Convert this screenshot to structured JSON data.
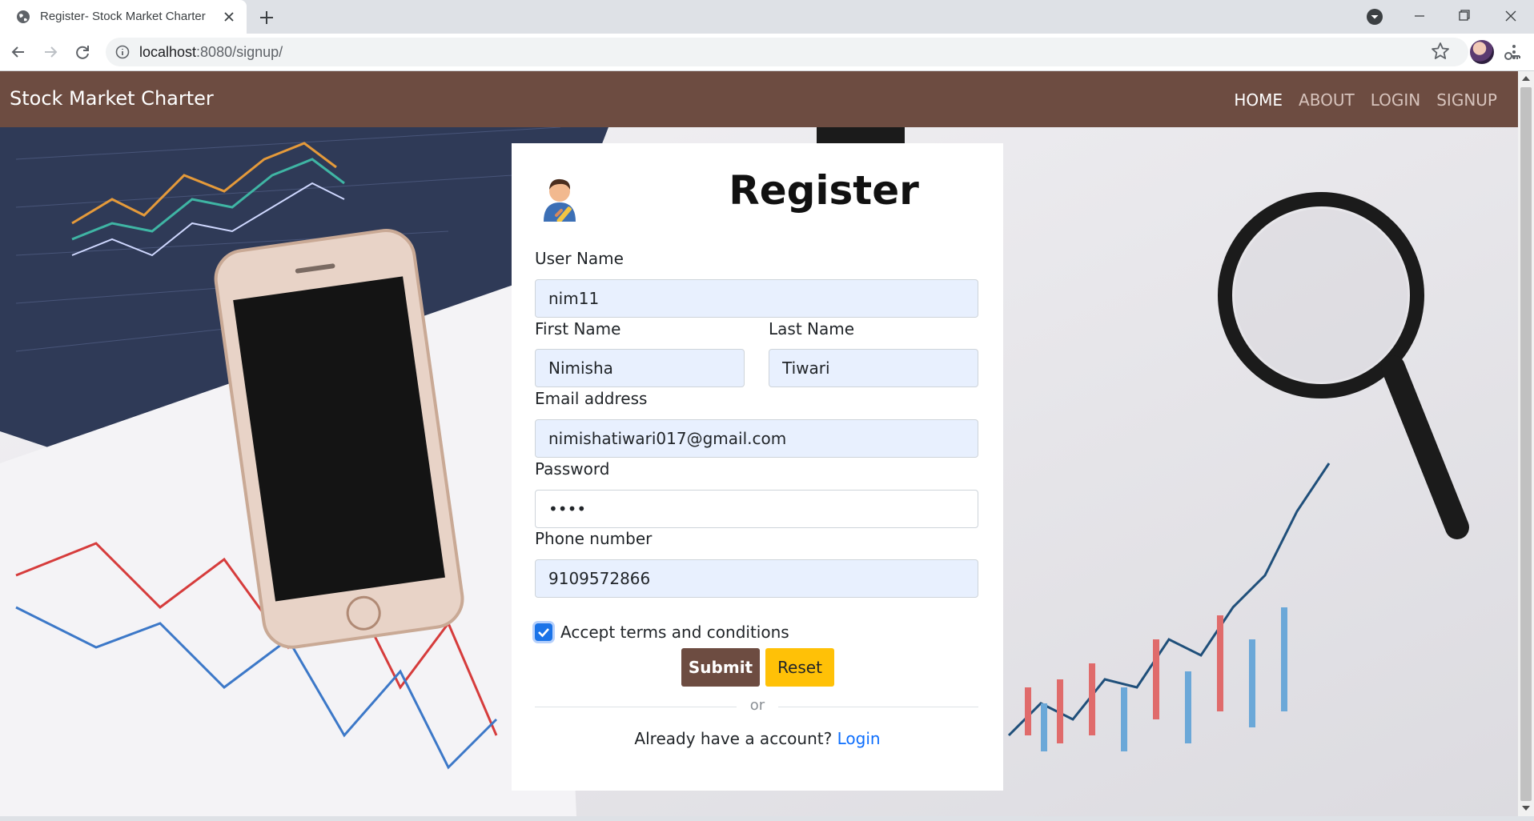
{
  "browser": {
    "tab_title": "Register- Stock Market Charter",
    "url_host": "localhost",
    "url_rest": ":8080/signup/",
    "icons": [
      "globe-icon",
      "close-icon",
      "plus-icon",
      "back-icon",
      "forward-icon",
      "reload-icon",
      "info-icon",
      "key-icon",
      "star-icon",
      "kebab-menu-icon"
    ]
  },
  "navbar": {
    "brand": "Stock Market Charter",
    "links": [
      "HOME",
      "ABOUT",
      "LOGIN",
      "SIGNUP"
    ],
    "active": "HOME",
    "color": "#6d4c41"
  },
  "form": {
    "title": "Register",
    "icon": "user-writing-icon",
    "username": {
      "label": "User Name",
      "value": "nim11"
    },
    "first_name": {
      "label": "First Name",
      "value": "Nimisha"
    },
    "last_name": {
      "label": "Last Name",
      "value": "Tiwari"
    },
    "email": {
      "label": "Email address",
      "value": "nimishatiwari017@gmail.com"
    },
    "password": {
      "label": "Password",
      "value": "1234"
    },
    "phone": {
      "label": "Phone number",
      "value": "9109572866"
    },
    "terms": {
      "label": "Accept terms and conditions",
      "checked": true
    },
    "submit_label": "Submit",
    "reset_label": "Reset",
    "divider_text": "or",
    "footer_text": "Already have a account?",
    "login_link": "Login",
    "colors": {
      "submit": "#6d4c41",
      "reset": "#ffc107",
      "link": "#0d6efd",
      "autofill": "#e8f0fe"
    }
  }
}
